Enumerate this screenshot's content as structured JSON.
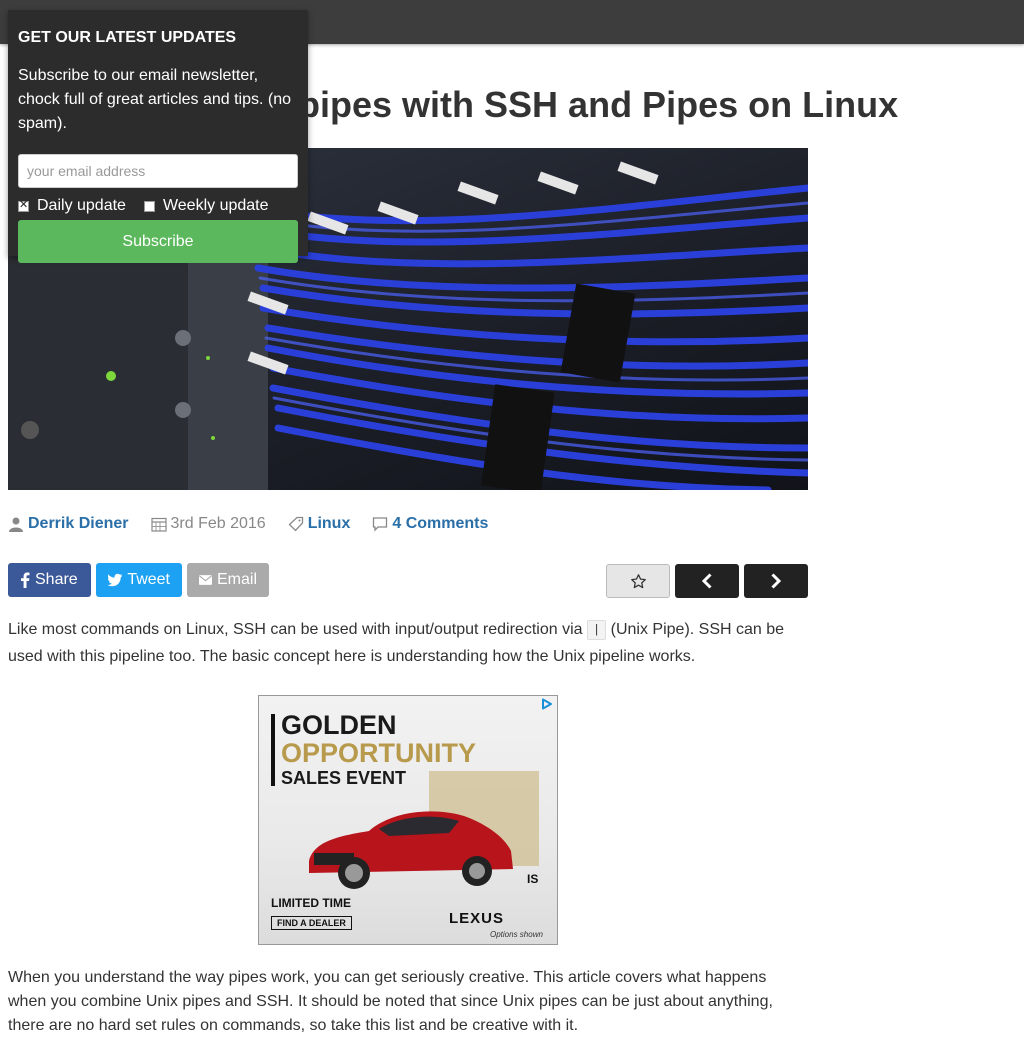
{
  "article": {
    "title": "How to use Unix pipes with SSH and Pipes on Linux"
  },
  "newsletter": {
    "heading": "GET OUR LATEST UPDATES",
    "description": "Subscribe to our email newsletter, chock full of great articles and tips. (no spam).",
    "email_placeholder": "your email address",
    "daily_label": "Daily update",
    "daily_checked": true,
    "weekly_label": "Weekly update",
    "weekly_checked": false,
    "subscribe_label": "Subscribe"
  },
  "meta": {
    "author": "Derrik Diener",
    "date": "3rd Feb 2016",
    "category": "Linux",
    "comments": "4 Comments"
  },
  "share": {
    "facebook_label": "Share",
    "twitter_label": "Tweet",
    "email_label": "Email"
  },
  "body": {
    "p1_before": "Like most commands on Linux, SSH can be used with input/output redirection via ",
    "p1_code": "|",
    "p1_after": " (Unix Pipe). SSH can be used with this pipeline too. The basic concept here is understanding how the Unix pipeline works.",
    "p2": "When you understand the way pipes work, you can get seriously creative. This article covers what happens when you combine Unix pipes and SSH. It should be noted that since Unix pipes can be just about anything, there are no hard set rules on commands, so take this list and be creative with it."
  },
  "ad": {
    "line1": "GOLDEN",
    "line2": "OPPORTUNITY",
    "line3": "SALES EVENT",
    "model": "IS",
    "limited": "LIMITED TIME",
    "dealer": "FIND A DEALER",
    "brand": "LEXUS",
    "options": "Options shown"
  },
  "icons": {
    "author": "person-icon",
    "date": "calendar-icon",
    "category": "tag-icon",
    "comments": "comment-icon",
    "facebook": "facebook-icon",
    "twitter": "twitter-icon",
    "email": "envelope-icon",
    "favorite": "star-icon",
    "prev": "chevron-left-icon",
    "next": "chevron-right-icon"
  },
  "colors": {
    "topbar": "#3d3d3d",
    "popup": "#2c2c2c",
    "subscribe": "#5cb85c",
    "link": "#2a6fa8",
    "facebook": "#3b5998",
    "twitter": "#1da1f2",
    "email": "#aaaaaa"
  }
}
